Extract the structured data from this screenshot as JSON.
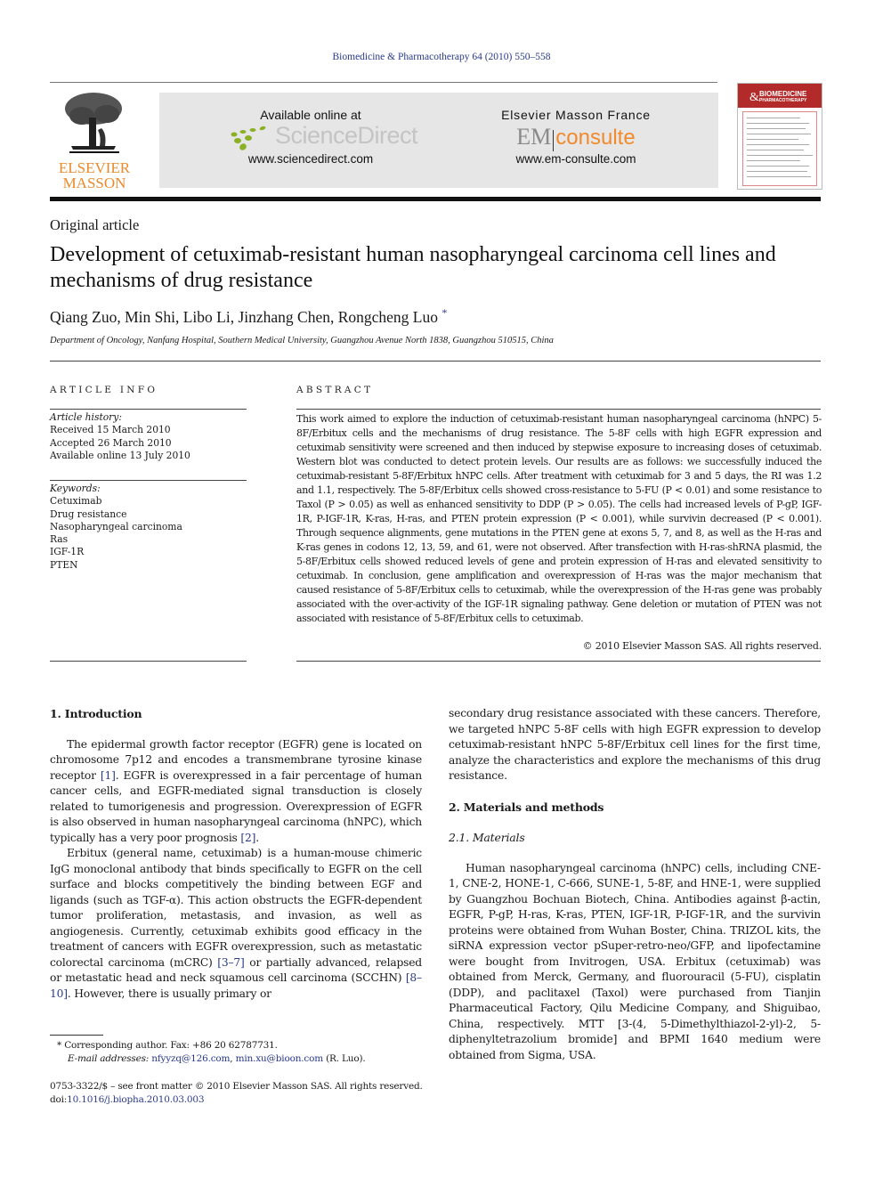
{
  "journal_ref": "Biomedicine & Pharmacotherapy 64 (2010) 550–558",
  "header": {
    "publisher_logo_line1": "ELSEVIER",
    "publisher_logo_line2": "MASSON",
    "sd_available": "Available online at",
    "sd_name": "ScienceDirect",
    "sd_url": "www.sciencedirect.com",
    "emc_publisher": "Elsevier Masson France",
    "emc_em": "EM",
    "emc_consulte": "consulte",
    "emc_url": "www.em-consulte.com",
    "cover_title_line1": "BIOMEDICINE",
    "cover_title_line2": "PHARMACOTHERAPY",
    "cover_amp": "&"
  },
  "colors": {
    "link": "#2a3a8a",
    "elsevier_orange": "#e98a2c",
    "cover_red": "#b32a2a",
    "banner_gray": "#e6e6e6",
    "sd_green": "#8ab023"
  },
  "article": {
    "type": "Original article",
    "title": "Development of cetuximab-resistant human nasopharyngeal carcinoma cell lines and mechanisms of drug resistance",
    "authors": "Qiang Zuo, Min Shi, Libo Li, Jinzhang Chen, Rongcheng Luo",
    "corresponding_mark": "*",
    "affiliation": "Department of Oncology, Nanfang Hospital, Southern Medical University, Guangzhou Avenue North 1838, Guangzhou 510515, China"
  },
  "article_info": {
    "heading": "ARTICLE INFO",
    "history_label": "Article history:",
    "history": [
      "Received 15 March 2010",
      "Accepted 26 March 2010",
      "Available online 13 July 2010"
    ],
    "keywords_label": "Keywords:",
    "keywords": [
      "Cetuximab",
      "Drug resistance",
      "Nasopharyngeal carcinoma",
      "Ras",
      "IGF-1R",
      "PTEN"
    ]
  },
  "abstract": {
    "heading": "ABSTRACT",
    "text": "This work aimed to explore the induction of cetuximab-resistant human nasopharyngeal carcinoma (hNPC) 5-8F/Erbitux cells and the mechanisms of drug resistance. The 5-8F cells with high EGFR expression and cetuximab sensitivity were screened and then induced by stepwise exposure to increasing doses of cetuximab. Western blot was conducted to detect protein levels. Our results are as follows: we successfully induced the cetuximab-resistant 5-8F/Erbitux hNPC cells. After treatment with cetuximab for 3 and 5 days, the RI was 1.2 and 1.1, respectively. The 5-8F/Erbitux cells showed cross-resistance to 5-FU (P < 0.01) and some resistance to Taxol (P > 0.05) as well as enhanced sensitivity to DDP (P > 0.05). The cells had increased levels of P-gP, IGF-1R, P-IGF-1R, K-ras, H-ras, and PTEN protein expression (P < 0.001), while survivin decreased (P < 0.001). Through sequence alignments, gene mutations in the PTEN gene at exons 5, 7, and 8, as well as the H-ras and K-ras genes in codons 12, 13, 59, and 61, were not observed. After transfection with H-ras-shRNA plasmid, the 5-8F/Erbitux cells showed reduced levels of gene and protein expression of H-ras and elevated sensitivity to cetuximab. In conclusion, gene amplification and overexpression of H-ras was the major mechanism that caused resistance of 5-8F/Erbitux cells to cetuximab, while the overexpression of the H-ras gene was probably associated with the over-activity of the IGF-1R signaling pathway. Gene deletion or mutation of PTEN was not associated with resistance of 5-8F/Erbitux cells to cetuximab.",
    "copyright": "© 2010 Elsevier Masson SAS. All rights reserved."
  },
  "body": {
    "intro_heading": "1.  Introduction",
    "intro_p1_a": "The epidermal growth factor receptor (EGFR) gene is located on chromosome 7p12 and encodes a transmembrane tyrosine kinase receptor ",
    "intro_p1_ref1": "[1]",
    "intro_p1_b": ". EGFR is overexpressed in a fair percentage of human cancer cells, and EGFR-mediated signal transduction is closely related to tumorigenesis and progression. Overexpression of EGFR is also observed in human nasopharyngeal carcinoma (hNPC), which typically has a very poor prognosis ",
    "intro_p1_ref2": "[2]",
    "intro_p1_c": ".",
    "intro_p2_a": "Erbitux (general name, cetuximab) is a human-mouse chimeric IgG monoclonal antibody that binds specifically to EGFR on the cell surface and blocks competitively the binding between EGF and ligands (such as TGF-α). This action obstructs the EGFR-dependent tumor proliferation, metastasis, and invasion, as well as angiogenesis. Currently, cetuximab exhibits good efficacy in the treatment of cancers with EGFR overexpression, such as metastatic colorectal carcinoma (mCRC) ",
    "intro_p2_ref1": "[3–7]",
    "intro_p2_b": " or partially advanced, relapsed or metastatic head and neck squamous cell carcinoma (SCCHN) ",
    "intro_p2_ref2": "[8–10]",
    "intro_p2_c": ". However, there is usually primary or",
    "intro_p2_cont": "secondary drug resistance associated with these cancers. Therefore, we targeted hNPC 5-8F cells with high EGFR expression to develop cetuximab-resistant hNPC 5-8F/Erbitux cell lines for the first time, analyze the characteristics and explore the mechanisms of this drug resistance.",
    "methods_heading": "2.  Materials and methods",
    "materials_heading": "2.1.  Materials",
    "materials_p": "Human nasopharyngeal carcinoma (hNPC) cells, including CNE-1, CNE-2, HONE-1, C-666, SUNE-1, 5-8F, and HNE-1, were supplied by Guangzhou Bochuan Biotech, China. Antibodies against β-actin, EGFR, P-gP, H-ras, K-ras, PTEN, IGF-1R, P-IGF-1R, and the survivin proteins were obtained from Wuhan Boster, China. TRIZOL kits, the siRNA expression vector pSuper-retro-neo/GFP, and lipofectamine were bought from Invitrogen, USA. Erbitux (cetuximab) was obtained from Merck, Germany, and fluorouracil (5-FU), cisplatin (DDP), and paclitaxel (Taxol) were purchased from Tianjin Pharmaceutical Factory, Qilu Medicine Company, and Shiguibao, China, respectively. MTT [3-(4, 5-Dimethylthiazol-2-yl)-2, 5-diphenyltetrazolium bromide] and BPMI 1640 medium were obtained from Sigma, USA."
  },
  "footnote": {
    "mark": "*",
    "corresponding": "Corresponding author. Fax: +86 20 62787731.",
    "email_label": "E-mail addresses:",
    "email1": "nfyyzq@126.com",
    "sep": ", ",
    "email2": "min.xu@bioon.com",
    "email_owner": " (R. Luo).",
    "front_matter": "0753-3322/$ – see front matter © 2010 Elsevier Masson SAS. All rights reserved.",
    "doi_label": "doi:",
    "doi": "10.1016/j.biopha.2010.03.003"
  }
}
